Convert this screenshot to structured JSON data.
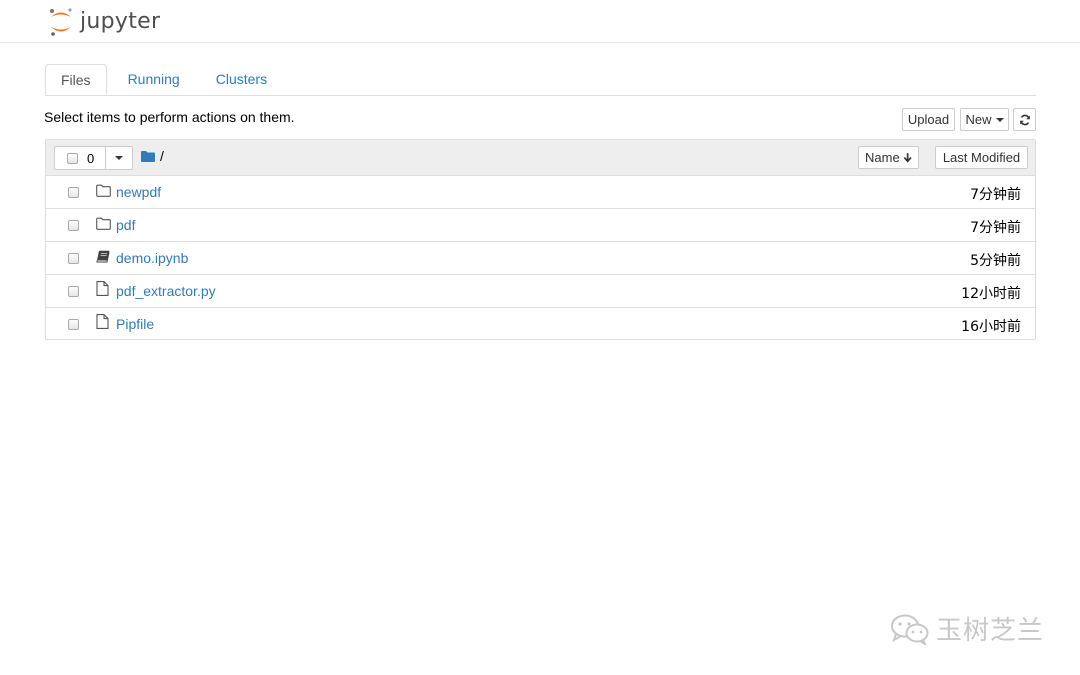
{
  "header": {
    "logo_text": "jupyter",
    "colors": {
      "brand_orange": "#f37726"
    }
  },
  "tabs": [
    {
      "label": "Files",
      "active": true
    },
    {
      "label": "Running",
      "active": false
    },
    {
      "label": "Clusters",
      "active": false
    }
  ],
  "toolbar": {
    "instructions": "Select items to perform actions on them.",
    "upload_label": "Upload",
    "new_label": "New",
    "refresh_icon": "refresh-icon"
  },
  "list_header": {
    "selected_count": "0",
    "breadcrumb_path": "/",
    "sort_name_label": "Name",
    "sort_name_icon": "arrow-down-icon",
    "sort_modified_label": "Last Modified"
  },
  "items": [
    {
      "name": "newpdf",
      "type": "folder",
      "icon": "folder-icon",
      "modified": "7分钟前"
    },
    {
      "name": "pdf",
      "type": "folder",
      "icon": "folder-icon",
      "modified": "7分钟前"
    },
    {
      "name": "demo.ipynb",
      "type": "notebook",
      "icon": "notebook-icon",
      "modified": "5分钟前"
    },
    {
      "name": "pdf_extractor.py",
      "type": "file",
      "icon": "file-icon",
      "modified": "12小时前"
    },
    {
      "name": "Pipfile",
      "type": "file",
      "icon": "file-icon",
      "modified": "16小时前"
    }
  ],
  "watermark": {
    "text": "玉树芝兰"
  }
}
